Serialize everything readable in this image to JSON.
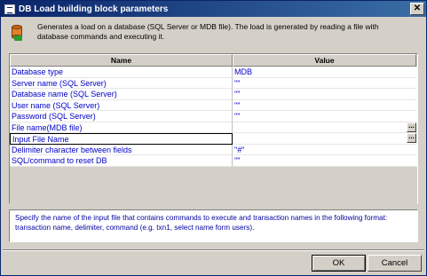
{
  "window": {
    "title": "DB Load building block parameters",
    "close_glyph": "✕"
  },
  "header": {
    "icon": "database-icon",
    "description": "Generates a load on a database (SQL Server or MDB file). The load is generated by reading a file with database commands and executing it."
  },
  "grid": {
    "columns": {
      "name": "Name",
      "value": "Value"
    },
    "rows": [
      {
        "name": "Database type",
        "value": "MDB"
      },
      {
        "name": "Server name (SQL Server)",
        "value": "\"\""
      },
      {
        "name": "Database name (SQL Server)",
        "value": "\"\""
      },
      {
        "name": "User name (SQL Server)",
        "value": "\"\""
      },
      {
        "name": "Password (SQL Server)",
        "value": "\"\""
      },
      {
        "name": "File name(MDB file)",
        "value": ""
      },
      {
        "name": "Input File Name",
        "value": ""
      },
      {
        "name": "Delimiter character between fields",
        "value": "\"#\""
      },
      {
        "name": "SQL/command to reset DB",
        "value": "\"\""
      }
    ],
    "ellipsis_label": "..."
  },
  "help_text": "Specify the name of the input file that contains commands to execute and transaction names in the following format: transaction name, delimiter, command (e.g. txn1, select name form users).",
  "buttons": {
    "ok": "OK",
    "cancel": "Cancel"
  }
}
